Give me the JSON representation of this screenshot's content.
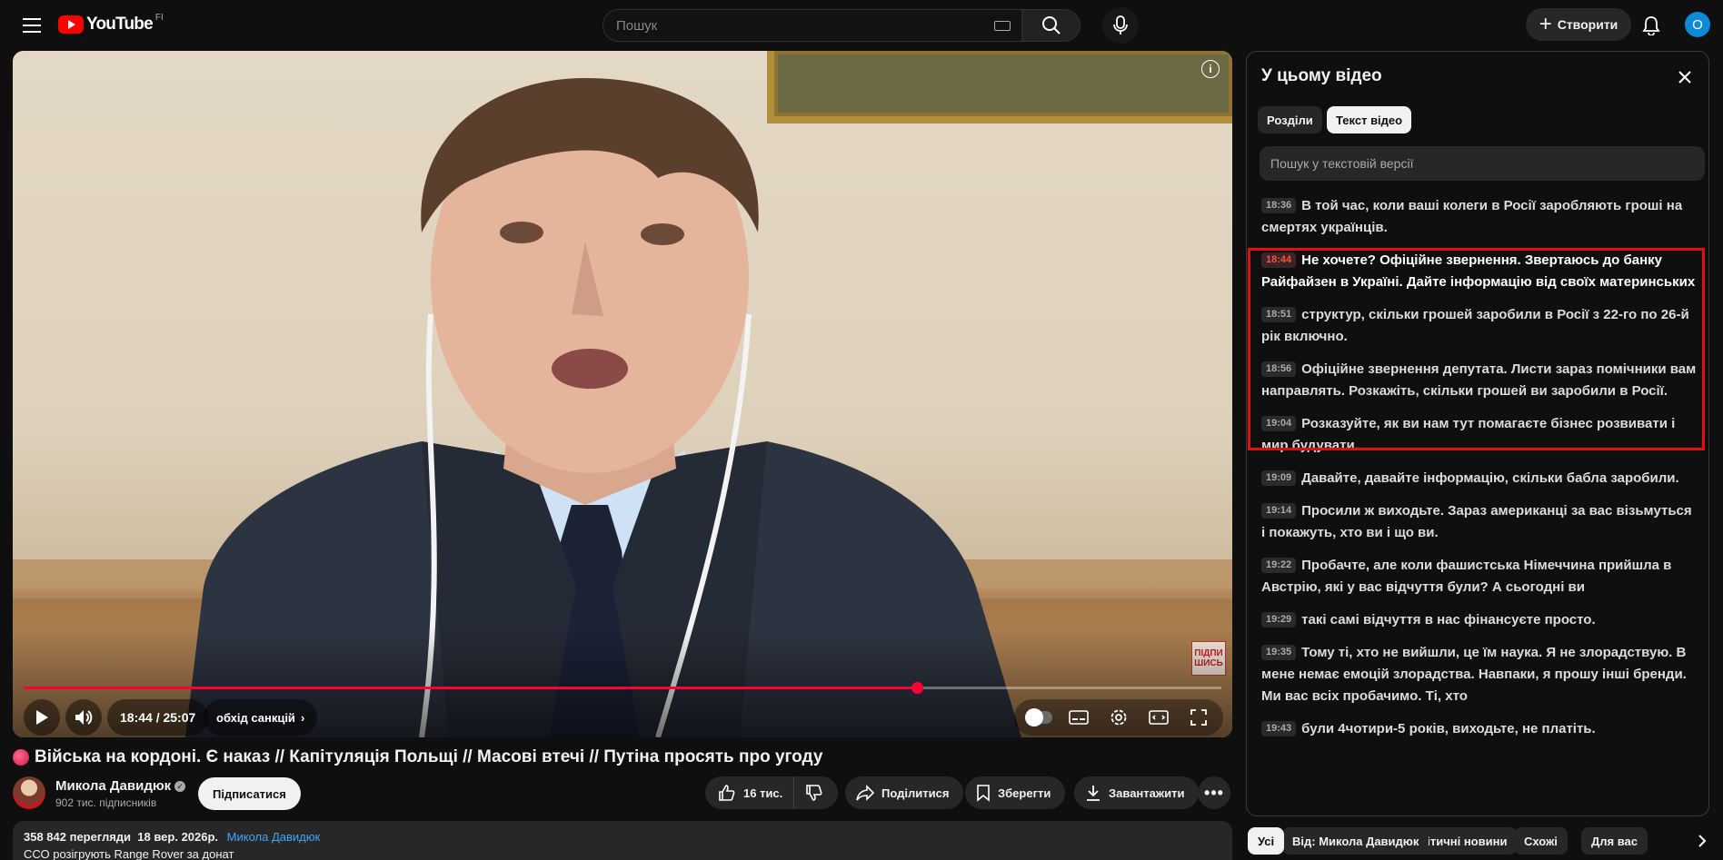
{
  "header": {
    "logo_text": "YouTube",
    "country_code": "FI",
    "search_placeholder": "Пошук",
    "create_label": "Створити",
    "avatar_letter": "O"
  },
  "player": {
    "current_time": "18:44",
    "duration": "25:07",
    "time_display": "18:44 / 25:07",
    "progress_fraction": 0.746,
    "chapter_label": "обхід санкцій",
    "watermark_text": "ПІДПИ\nШИСЬ"
  },
  "video": {
    "title": "Війська на кордоні. Є наказ // Капітуляція Польщі // Масові втечі // Путіна просять про угоду",
    "channel_name": "Микола Давидюк",
    "subscribers": "902 тис. підписників",
    "subscribe_label": "Підписатися",
    "likes": "16 тис.",
    "share_label": "Поділитися",
    "save_label": "Зберегти",
    "download_label": "Завантажити",
    "more_label": "•••"
  },
  "description": {
    "views": "358 842 перегляди",
    "date": "18 вер. 2026р.",
    "channel_link": "Микола Давидюк",
    "first_line": "ССО розігрують Range Rover за донат"
  },
  "panel": {
    "title": "У цьому відео",
    "tab_chapters": "Розділи",
    "tab_transcript": "Текст відео",
    "search_placeholder": "Пошук у текстовій версії",
    "segments": [
      {
        "time": "18:36",
        "text": "В той час, коли ваші колеги в Росії заробляють гроші на смертях українців."
      },
      {
        "time": "18:44",
        "text": "Не хочете? Офіційне звернення. Звертаюсь до банку Райфайзен в Україні. Дайте інформацію від своїх материнських"
      },
      {
        "time": "18:51",
        "text": "структур, скільки грошей заробили в Росії з 22-го по 26-й рік включно."
      },
      {
        "time": "18:56",
        "text": "Офіційне звернення депутата. Листи зараз помічники вам направлять. Розкажіть, скільки грошей ви заробили в Росії."
      },
      {
        "time": "19:04",
        "text": "Розказуйте, як ви нам тут помагаєте бізнес розвивати і мир будувати."
      },
      {
        "time": "19:09",
        "text": "Давайте, давайте інформацію, скільки бабла заробили."
      },
      {
        "time": "19:14",
        "text": "Просили ж виходьте. Зараз американці за вас візьмуться і покажуть, хто ви і що ви."
      },
      {
        "time": "19:22",
        "text": "Пробачте, але коли фашистська Німеччина прийшла в Австрію, які у вас відчуття були? А сьогодні ви"
      },
      {
        "time": "19:29",
        "text": "такі самі відчуття в нас фінансуєте просто."
      },
      {
        "time": "19:35",
        "text": "Тому ті, хто не вийшли, це їм наука. Я не злорадствую. В мене немає емоцій злорадства. Навпаки, я прошу інші бренди. Ми вас всіх пробачимо. Ті, хто"
      },
      {
        "time": "19:43",
        "text": "були 4чотири-5 років, виходьте, не платіть."
      }
    ]
  },
  "chips": [
    "Усі",
    "Від: Микола Давидюк",
    "Політичні новини",
    "Схожі",
    "Для вас"
  ],
  "colors": {
    "accent_red": "#ff0033",
    "highlight_border": "#e01010",
    "link_blue": "#3ea6ff",
    "background": "#0f0f0f"
  }
}
